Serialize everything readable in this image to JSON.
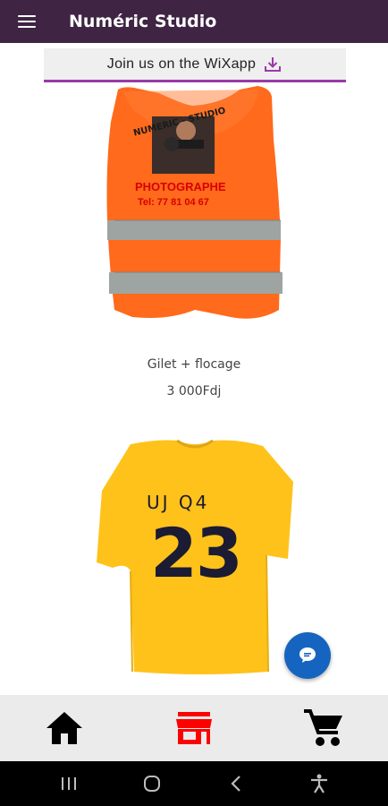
{
  "header": {
    "title": "Numéric Studio"
  },
  "banner": {
    "text": "Join us on the WiXapp"
  },
  "products": [
    {
      "name": "Gilet + flocage",
      "price": "3 000Fdj",
      "image_text": {
        "line1": "NUMERIC - STUDIO",
        "line2": "PHOTOGRAPHE",
        "line3": "Tel: 77 81 04 67"
      },
      "color": "#ff6a1c"
    },
    {
      "image_text": {
        "line1": "UJ Q4",
        "line2": "23"
      },
      "color": "#ffc21a"
    }
  ],
  "colors": {
    "header": "#3f2444",
    "accent": "#9a3aa8",
    "fab": "#1565c0",
    "active_nav": "#ff0000"
  },
  "bottom_nav": [
    {
      "icon": "home-icon",
      "active": false
    },
    {
      "icon": "store-icon",
      "active": true
    },
    {
      "icon": "cart-icon",
      "active": false
    }
  ]
}
